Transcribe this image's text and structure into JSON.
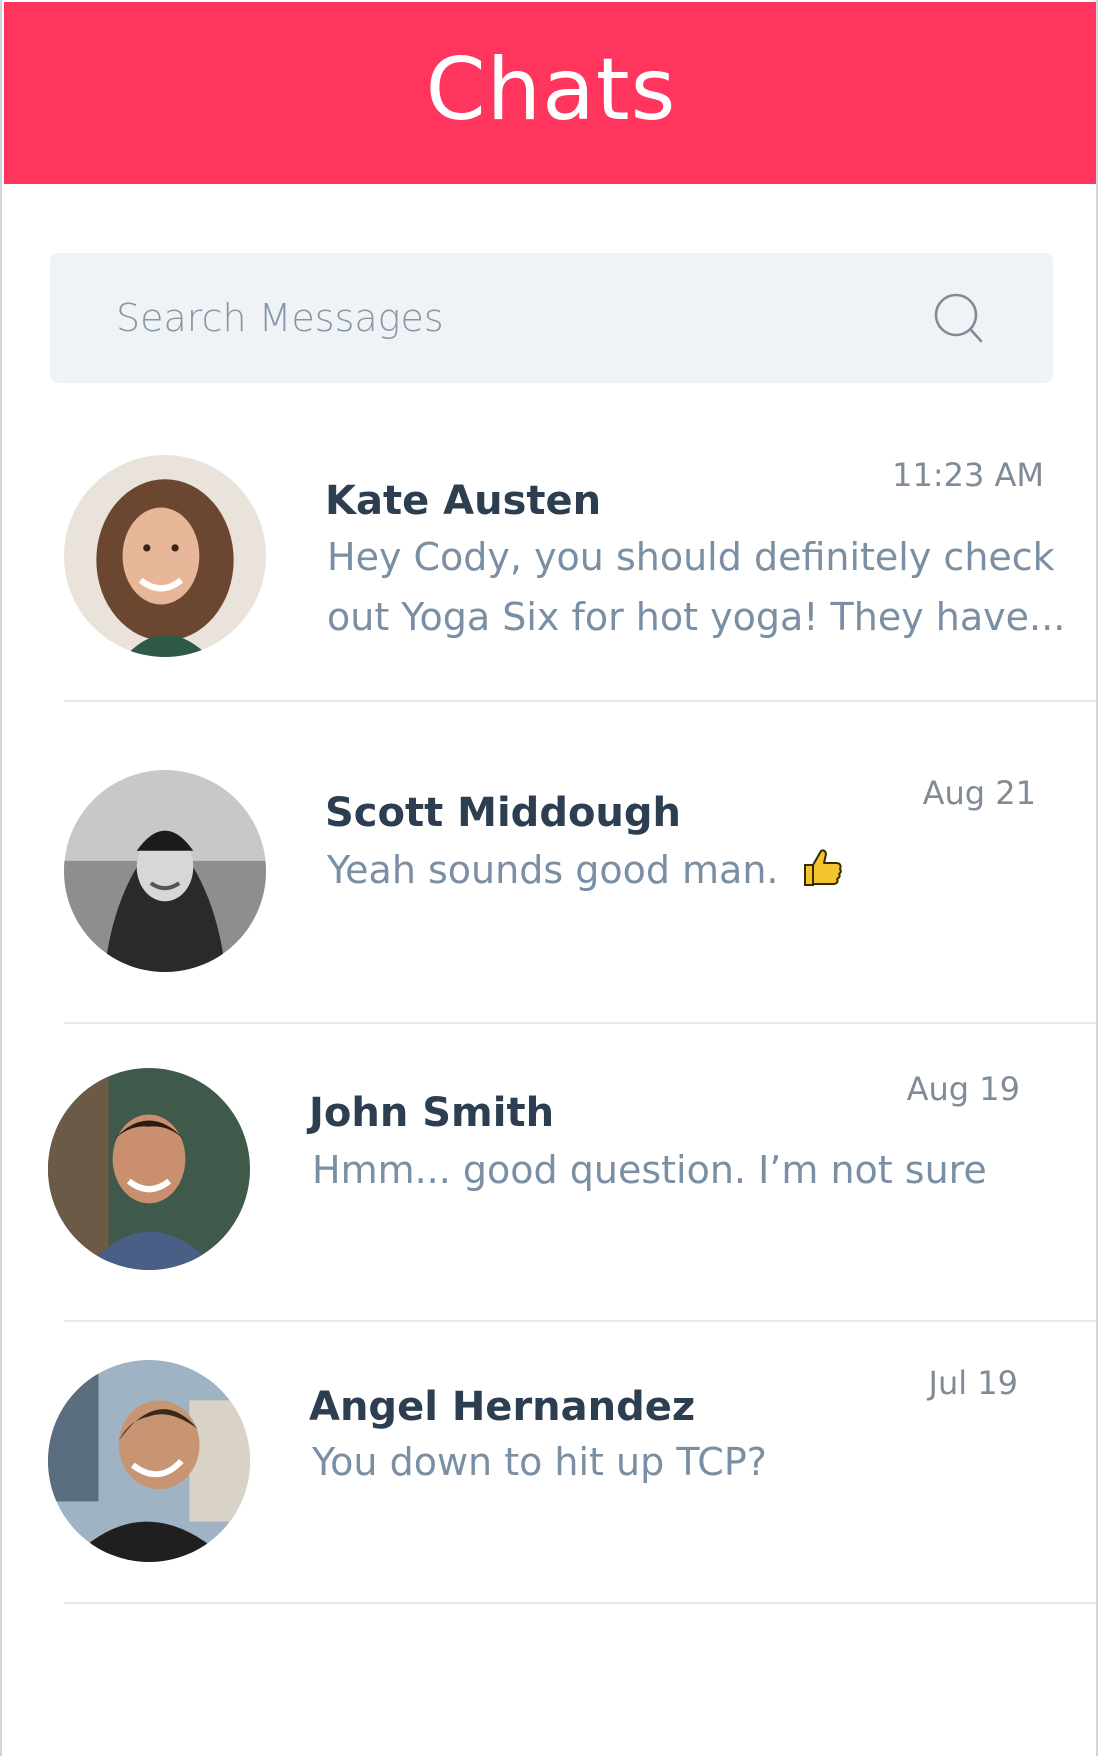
{
  "header": {
    "title": "Chats"
  },
  "search": {
    "placeholder": "Search Messages",
    "icon": "search-icon"
  },
  "colors": {
    "accent": "#ff355e",
    "name": "#2c3e50",
    "message": "#7a8fa3",
    "time": "#7f8c97",
    "search_bg": "#f0f3f5"
  },
  "chats": [
    {
      "name": "Kate Austen",
      "time": "11:23 AM",
      "message_line1": "Hey Cody, you should definitely check",
      "message_line2": "out Yoga Six for hot yoga! They have..."
    },
    {
      "name": "Scott Middough",
      "time": "Aug 21",
      "message": "Yeah sounds good man.",
      "emoji": "thumbs-up-icon"
    },
    {
      "name": "John Smith",
      "time": "Aug 19",
      "message": "Hmm... good question. I’m not sure"
    },
    {
      "name": "Angel Hernandez",
      "time": "Jul 19",
      "message": "You down to hit up TCP?"
    }
  ]
}
